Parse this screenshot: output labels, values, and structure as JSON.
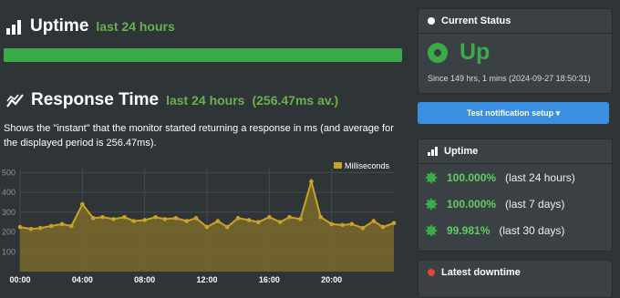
{
  "uptime_section": {
    "title": "Uptime",
    "subtitle": "last 24 hours",
    "percent": 1.0
  },
  "response_section": {
    "title": "Response Time",
    "subtitle": "last 24 hours",
    "average": "(256.47ms av.)",
    "description": "Shows the \"instant\" that the monitor started returning a response in ms (and average for the displayed period is 256.47ms)."
  },
  "chart_data": {
    "type": "area",
    "legend": "Milliseconds",
    "legend_placement": "top-right",
    "yticks": [
      "500",
      "400",
      "300",
      "200",
      "100"
    ],
    "xticks": [
      "00:00",
      "04:00",
      "08:00",
      "12:00",
      "16:00",
      "20:00"
    ],
    "ylim": [
      0,
      520
    ],
    "xlim": [
      0,
      24
    ],
    "x": [
      0.0,
      0.7,
      1.3,
      2.0,
      2.7,
      3.3,
      4.0,
      4.7,
      5.3,
      6.0,
      6.7,
      7.3,
      8.0,
      8.7,
      9.3,
      10.0,
      10.7,
      11.3,
      12.0,
      12.7,
      13.3,
      14.0,
      14.7,
      15.3,
      16.0,
      16.7,
      17.3,
      18.0,
      18.7,
      19.3,
      20.0,
      20.7,
      21.3,
      22.0,
      22.7,
      23.3,
      24.0
    ],
    "values": [
      225,
      215,
      220,
      230,
      240,
      230,
      340,
      270,
      275,
      265,
      275,
      255,
      260,
      275,
      265,
      270,
      255,
      270,
      225,
      255,
      225,
      270,
      260,
      250,
      275,
      250,
      275,
      265,
      455,
      275,
      240,
      235,
      240,
      220,
      255,
      225,
      245
    ],
    "grid": true,
    "color": "#c9a227"
  },
  "current_status": {
    "title": "Current Status",
    "state": "Up",
    "since": "Since 149 hrs, 1 mins (2024-09-27 18:50:31)",
    "color": "#3bab49"
  },
  "test_button": {
    "label": "Test notification setup ▾"
  },
  "uptime_panel": {
    "title": "Uptime",
    "items": [
      {
        "value": "100.000%",
        "period": "(last 24 hours)"
      },
      {
        "value": "100.000%",
        "period": "(last 7 days)"
      },
      {
        "value": "99.981%",
        "period": "(last 30 days)"
      }
    ]
  },
  "downtime_panel": {
    "title": "Latest downtime"
  }
}
